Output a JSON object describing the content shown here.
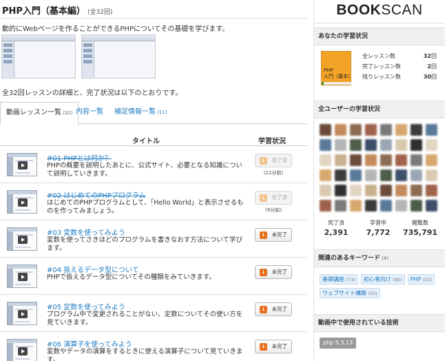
{
  "course": {
    "title": "PHP入門（基本編）",
    "count_label": "(全32回)",
    "intro": "動的にWebページを作ることができるPHPについてその基礎を学びます。",
    "summary": "全32回レッスンの詳細と、完了状況は以下のとおりです。"
  },
  "tabs": [
    {
      "label": "動画レッスン一覧",
      "count": "(32)"
    },
    {
      "label": "内容一覧",
      "count": ""
    },
    {
      "label": "補足情報一覧",
      "count": "(11)"
    }
  ],
  "table": {
    "col_title": "タイトル",
    "col_status": "学習状況"
  },
  "lessons": [
    {
      "title": "#01 PHPとは何か？",
      "desc": "PHPの概要を説明したあとに、公式サイト、必要となる知識について説明していきます。",
      "status": "完了済",
      "duration": "(12分前)"
    },
    {
      "title": "#02 はじめてのPHPプログラム",
      "desc": "はじめてのPHPプログラムとして、「Hello World」と表示させるものを作ってみましょう。",
      "status": "完了済",
      "duration": "(9分前)"
    },
    {
      "title": "#03 変数を使ってみよう",
      "desc": "変数を使ってさきほどのプログラムを書きなおす方法について学びます。",
      "status": "未完了",
      "duration": ""
    },
    {
      "title": "#04 扱えるデータ型について",
      "desc": "PHPで扱えるデータ型についてその種類をみていきます。",
      "status": "未完了",
      "duration": ""
    },
    {
      "title": "#05 定数を使ってみよう",
      "desc": "プログラム中で変更されることがない、定数についてその使い方を見ていきます。",
      "status": "未完了",
      "duration": ""
    },
    {
      "title": "#06 演算子を使ってみよう",
      "desc": "変数やデータの演算をするときに使える演算子について見ていきます。",
      "status": "未完了",
      "duration": ""
    }
  ],
  "sidebar": {
    "logo_bold": "BOOK",
    "logo_rest": "SCAN",
    "my_status": {
      "heading": "あなたの学習状況",
      "book_label_1": "PHP",
      "book_label_2": "入門（基本）",
      "progress_fraction": 0.06,
      "rows": [
        {
          "label": "全レッスン数",
          "value": "32",
          "unit": "回"
        },
        {
          "label": "完了レッスン数",
          "value": "2",
          "unit": "回"
        },
        {
          "label": "残りレッスン数",
          "value": "30",
          "unit": "回"
        }
      ]
    },
    "all_users": {
      "heading": "全ユーザーの学習状況",
      "stats": [
        {
          "label": "完了済",
          "value": "2,391"
        },
        {
          "label": "学習中",
          "value": "7,772"
        },
        {
          "label": "閲覧数",
          "value": "735,791"
        }
      ]
    },
    "keywords": {
      "heading": "関連のあるキーワード",
      "count": "(4)",
      "items": [
        {
          "label": "基礎講座",
          "count": "(73)"
        },
        {
          "label": "初心者向け",
          "count": "(85)"
        },
        {
          "label": "PHP",
          "count": "(33)"
        },
        {
          "label": "ウェブサイト構築",
          "count": "(55)"
        }
      ]
    },
    "tech": {
      "heading": "動画中で使用されている技術",
      "badge": "php 5.3.13"
    }
  },
  "colors": {
    "link": "#1f7cc1",
    "incomplete_icon": "#e8711f",
    "book_cover": "#f3a326"
  }
}
